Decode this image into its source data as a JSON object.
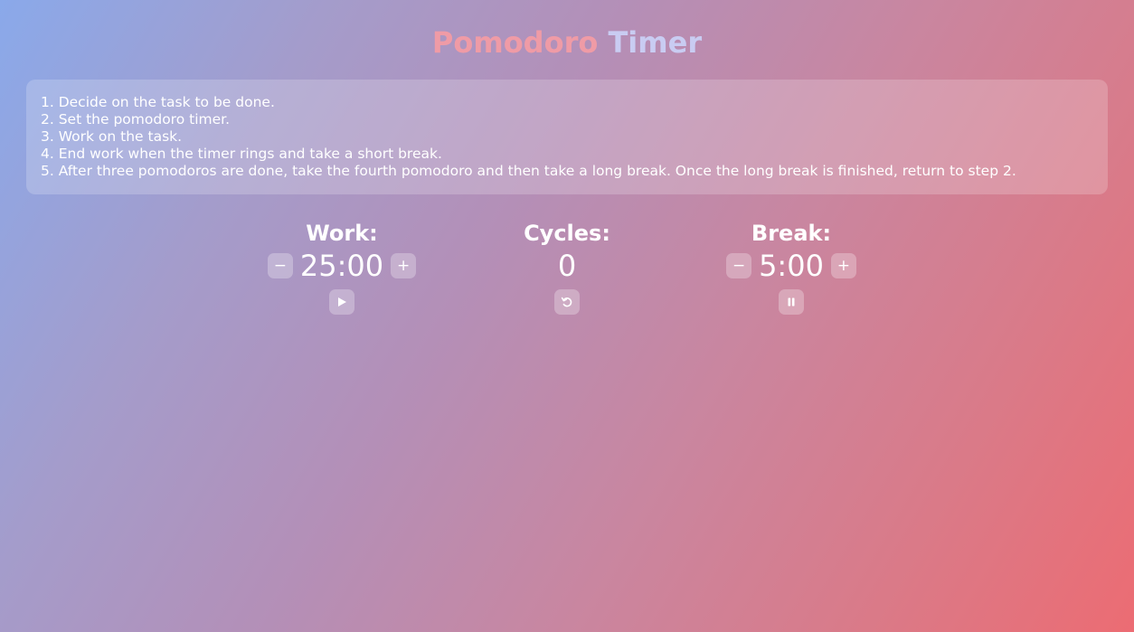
{
  "title": {
    "word1": "Pomodoro",
    "word2": "Timer",
    "colors": {
      "word1": "#ef9ba6",
      "word2": "#c9ccf2"
    }
  },
  "instructions": [
    "1. Decide on the task to be done.",
    "2. Set the pomodoro timer.",
    "3. Work on the task.",
    "4. End work when the timer rings and take a short break.",
    "5. After three pomodoros are done, take the fourth pomodoro and then take a long break. Once the long break is finished, return to step 2."
  ],
  "work": {
    "label": "Work:",
    "value": "25:00",
    "decrement_label": "−",
    "increment_label": "+",
    "action_icon": "play-icon"
  },
  "cycles": {
    "label": "Cycles:",
    "value": "0",
    "action_icon": "reset-icon"
  },
  "break": {
    "label": "Break:",
    "value": "5:00",
    "decrement_label": "−",
    "increment_label": "+",
    "action_icon": "pause-icon"
  },
  "colors": {
    "gradient_start": "#8aa9ea",
    "gradient_end": "#ec6c73",
    "text": "#ffffff"
  }
}
